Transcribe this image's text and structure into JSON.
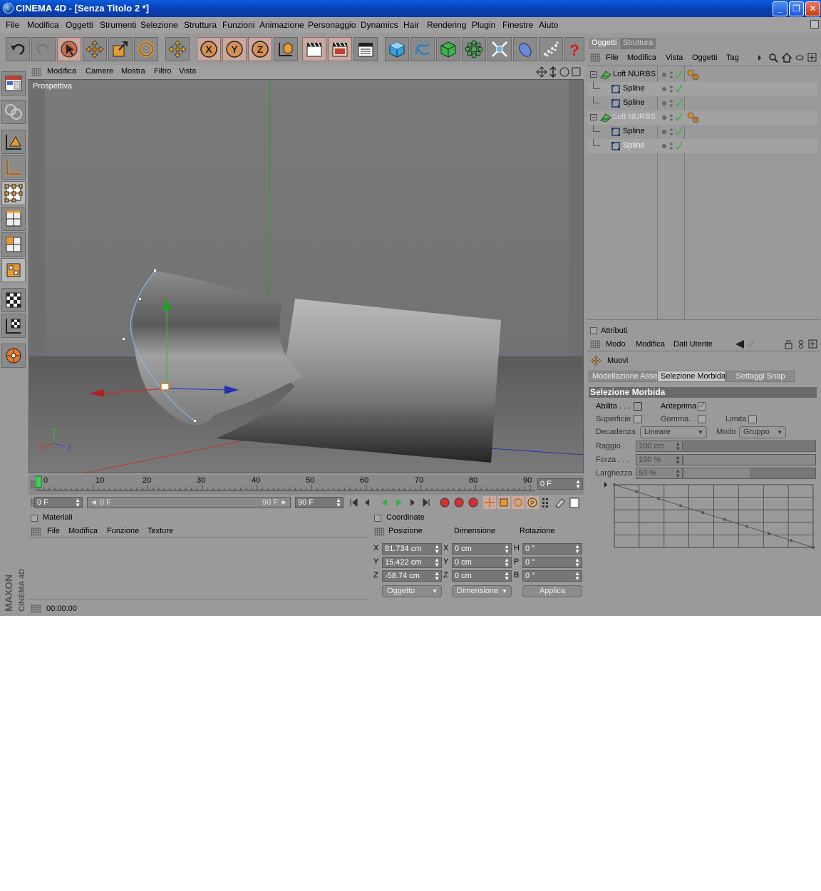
{
  "window": {
    "title": "CINEMA 4D - [Senza Titolo 2 *]",
    "controls": {
      "minimize": "_",
      "maximize": "❐",
      "close": "✕"
    }
  },
  "menu": [
    "File",
    "Modifica",
    "Oggetti",
    "Strumenti",
    "Selezione",
    "Struttura",
    "Funzioni",
    "Animazione",
    "Personaggio",
    "Dynamics",
    "Hair",
    "Rendering",
    "Plugin",
    "Finestre",
    "Aiuto"
  ],
  "toolbar_icons": [
    "undo-icon",
    "redo-icon",
    "select-icon",
    "move-icon",
    "scale-icon",
    "rotate-icon",
    "move-tool-icon",
    "x-axis-icon",
    "y-axis-icon",
    "z-axis-icon",
    "world-coord-icon",
    "render-view-icon",
    "render-picture-icon",
    "render-settings-icon",
    "cube-icon",
    "spline-icon",
    "nurbs-icon",
    "array-icon",
    "deformer-icon",
    "scene-icon",
    "particle-icon",
    "help-icon"
  ],
  "toolbar_axis_letters": [
    "X",
    "Y",
    "Z"
  ],
  "left_icons": [
    "layout-icon",
    "model-icon",
    "object-tool-icon",
    "axis-tool-icon",
    "points-icon",
    "edges-icon",
    "polygons-icon",
    "uvw-icon",
    "texture-icon",
    "texture-axis-icon",
    "animation-icon"
  ],
  "brand": {
    "line1": "MAXON",
    "line2": "CINEMA 4D"
  },
  "viewport": {
    "menu": [
      "Modifica",
      "Camere",
      "Mostra",
      "Filtro",
      "Vista"
    ],
    "label": "Prospettiva",
    "axis_labels": {
      "x": "X",
      "y": "Y",
      "z": "Z"
    }
  },
  "timeline": {
    "ticks": [
      "0",
      "10",
      "20",
      "30",
      "40",
      "50",
      "60",
      "70",
      "80",
      "90"
    ],
    "current": "0 F"
  },
  "transport": {
    "start": "0 F",
    "range_start": "0 F",
    "range_end": "90 F",
    "end": "90 F"
  },
  "materials": {
    "title": "Materiali",
    "menu": [
      "File",
      "Modifica",
      "Funzione",
      "Texture"
    ]
  },
  "coordinates": {
    "title": "Coordinate",
    "headers": [
      "Posizione",
      "Dimensione",
      "Rotazione"
    ],
    "rows": [
      {
        "axis": "X",
        "pos": "81.734 cm",
        "daxis": "X",
        "dim": "0 cm",
        "raxis": "H",
        "rot": "0 °"
      },
      {
        "axis": "Y",
        "pos": "15.422 cm",
        "daxis": "Y",
        "dim": "0 cm",
        "raxis": "P",
        "rot": "0 °"
      },
      {
        "axis": "Z",
        "pos": "-58.74 cm",
        "daxis": "Z",
        "dim": "0 cm",
        "raxis": "B",
        "rot": "0 °"
      }
    ],
    "mode_select": "Oggetto",
    "dim_select": "Dimensione",
    "apply": "Applica"
  },
  "status": {
    "time": "00:00:00"
  },
  "objects_panel": {
    "tabs": [
      "Oggetti",
      "Struttura"
    ],
    "menu": [
      "File",
      "Modifica",
      "Vista",
      "Oggetti",
      "Tag"
    ],
    "items": [
      {
        "name": "Loft NURBS",
        "level": 0,
        "type": "loft",
        "dim": false,
        "tag": true
      },
      {
        "name": "Spline",
        "level": 1,
        "type": "spline",
        "dim": false,
        "tag": false
      },
      {
        "name": "Spline",
        "level": 1,
        "type": "spline",
        "dim": false,
        "tag": false
      },
      {
        "name": "Loft NURBS",
        "level": 0,
        "type": "loft",
        "dim": true,
        "tag": true
      },
      {
        "name": "Spline",
        "level": 1,
        "type": "spline",
        "dim": false,
        "tag": false
      },
      {
        "name": "Spline",
        "level": 1,
        "type": "spline",
        "dim": false,
        "tag": false
      }
    ]
  },
  "attributes": {
    "title": "Attributi",
    "menu": [
      "Modo",
      "Modifica",
      "Dati Utente"
    ],
    "tool_name": "Muovi",
    "tabs": [
      "Modellazione Asse",
      "Selezione Morbida",
      "Settaggi Snap"
    ],
    "section": "Selezione Morbida",
    "abilita": "Abilita . . .",
    "anteprima": "Anteprima",
    "superficie": "Superficie",
    "gomma": "Gomma. .",
    "limita": "Limita",
    "decadenza_label": "Decadenza",
    "decadenza_value": "Lineare",
    "modo_label": "Modo",
    "modo_value": "Gruppo",
    "raggio_label": "Raggio . .",
    "raggio_value": "100 cm",
    "raggio_fraction": 0.0,
    "forza_label": "Forza . . .",
    "forza_value": "100 %",
    "forza_fraction": 1.0,
    "larghezza_label": "Larghezza",
    "larghezza_value": "50 %",
    "larghezza_fraction": 0.5
  },
  "colors": {
    "accent": "#d87a2a",
    "selected_tab": "#c8c8c8",
    "title_blue": "#0a5de0"
  }
}
